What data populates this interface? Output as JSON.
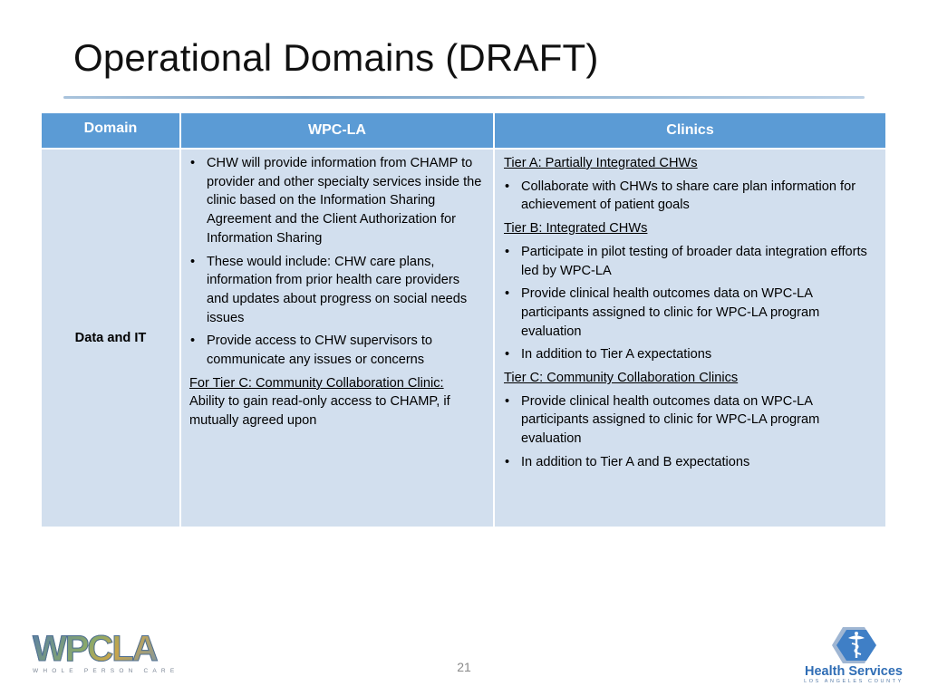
{
  "slide": {
    "title": "Operational Domains (DRAFT)",
    "page_number": "21"
  },
  "table": {
    "headers": {
      "domain": "Domain",
      "wpc": "WPC-LA",
      "clinics": "Clinics"
    },
    "row": {
      "domain": "Data and IT",
      "wpc": {
        "bullets": [
          "CHW will provide information from CHAMP to provider and other specialty services inside the clinic based on the Information Sharing Agreement and the Client Authorization for Information Sharing",
          "These would include: CHW care plans, information from prior health care providers and updates about progress on social needs issues",
          "Provide access to CHW supervisors to communicate any issues or concerns"
        ],
        "tier_c_heading": "For Tier C: Community Collaboration Clinic:",
        "tier_c_text": "Ability to gain read-only access to CHAMP, if mutually agreed upon"
      },
      "clinics": {
        "tier_a_heading": "Tier A: Partially Integrated CHWs",
        "tier_a_bullets": [
          "Collaborate with CHWs to share care plan information for achievement of patient goals"
        ],
        "tier_b_heading": "Tier B: Integrated CHWs",
        "tier_b_bullets": [
          "Participate in pilot testing of broader data integration efforts led by WPC-LA",
          "Provide clinical health outcomes data on WPC-LA participants assigned to clinic for WPC-LA program evaluation",
          "In addition to Tier A expectations"
        ],
        "tier_c_heading": "Tier C: Community Collaboration Clinics",
        "tier_c_bullets": [
          "Provide clinical health outcomes data on WPC-LA participants assigned to clinic for WPC-LA program evaluation",
          "In addition to Tier A and B expectations"
        ]
      }
    }
  },
  "logos": {
    "wpc": {
      "letters": "WPCLA",
      "subtitle": "WHOLE PERSON CARE"
    },
    "dhs": {
      "name": "Health Services",
      "subtitle": "LOS ANGELES COUNTY"
    }
  },
  "colors": {
    "header_blue": "#5b9bd5",
    "cell_blue": "#d2dfee",
    "dhs_blue": "#2f6db5"
  }
}
